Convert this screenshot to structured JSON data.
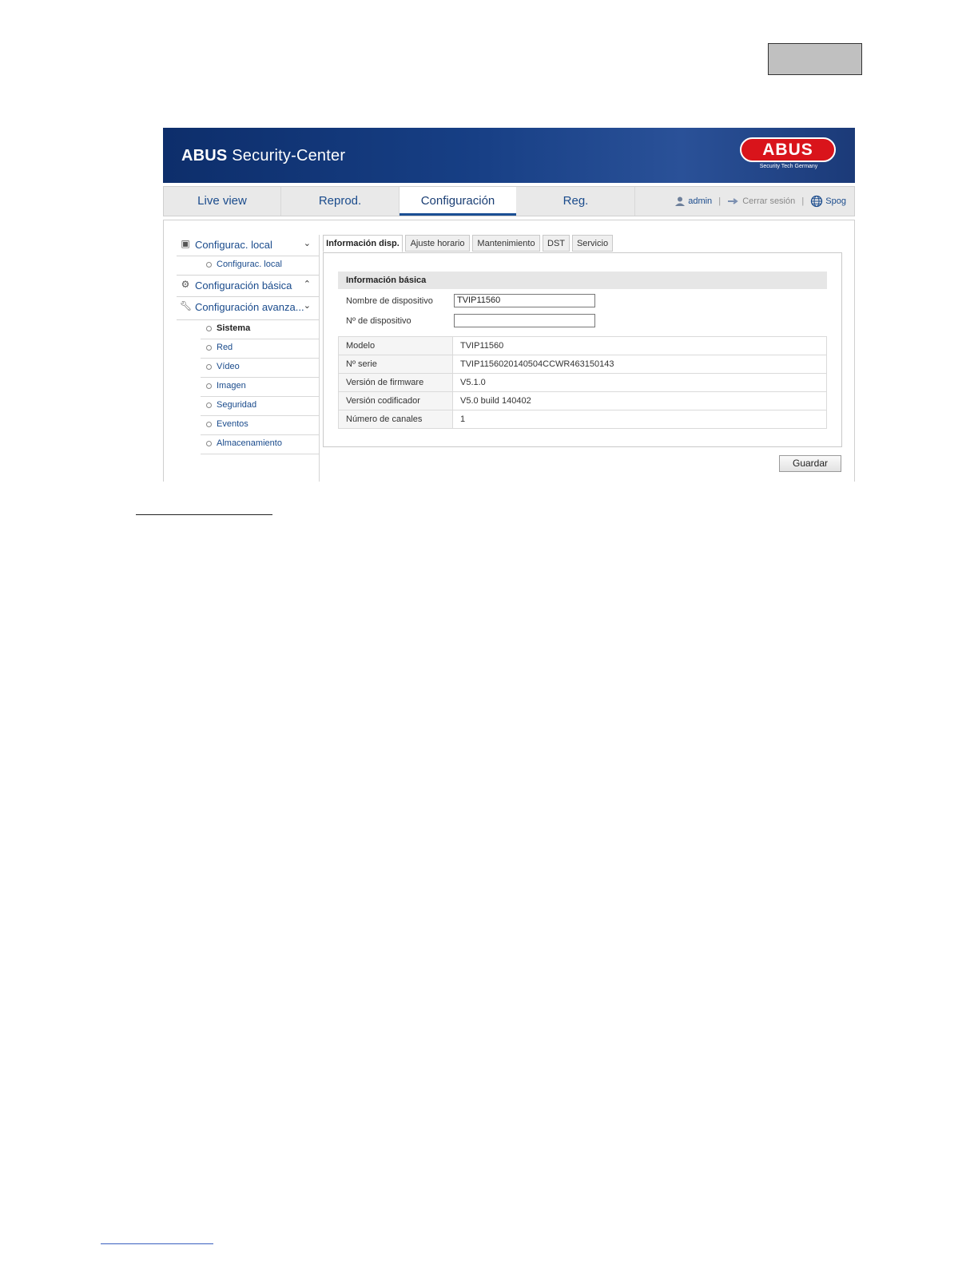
{
  "banner": {
    "brand": "ABUS",
    "title": "Security-Center",
    "logo_text": "ABUS",
    "logo_tagline": "Security Tech Germany"
  },
  "nav": {
    "tabs": [
      "Live view",
      "Reprod.",
      "Configuración",
      "Reg."
    ],
    "active": "Configuración",
    "user": "admin",
    "logout": "Cerrar sesión",
    "language": "Spog"
  },
  "sidebar": {
    "sections": [
      {
        "label": "Configurac. local",
        "icon": "monitor-icon",
        "expanded": true,
        "items": [
          "Configurac. local"
        ]
      },
      {
        "label": "Configuración básica",
        "icon": "gear-icon",
        "expanded": false,
        "items": []
      },
      {
        "label": "Configuración avanza...",
        "icon": "wrench-icon",
        "expanded": true,
        "items": [
          "Sistema",
          "Red",
          "Vídeo",
          "Imagen",
          "Seguridad",
          "Eventos",
          "Almacenamiento"
        ]
      }
    ],
    "active_item": "Sistema"
  },
  "tabs": [
    "Información disp.",
    "Ajuste horario",
    "Mantenimiento",
    "DST",
    "Servicio"
  ],
  "active_tab": "Información disp.",
  "basic_info": {
    "heading": "Información básica",
    "device_name_label": "Nombre de dispositivo",
    "device_name_value": "TVIP11560",
    "device_no_label": "Nº de dispositivo",
    "device_no_value": "",
    "rows": [
      {
        "key": "Modelo",
        "value": "TVIP11560"
      },
      {
        "key": "Nº serie",
        "value": "TVIP1156020140504CCWR463150143"
      },
      {
        "key": "Versión de firmware",
        "value": "V5.1.0"
      },
      {
        "key": "Versión codificador",
        "value": "V5.0 build 140402"
      },
      {
        "key": "Número de canales",
        "value": "1"
      }
    ]
  },
  "save_label": "Guardar",
  "colors": {
    "banner": "#173f85",
    "accent": "#1a4b8c",
    "logo_red": "#d9141b"
  }
}
